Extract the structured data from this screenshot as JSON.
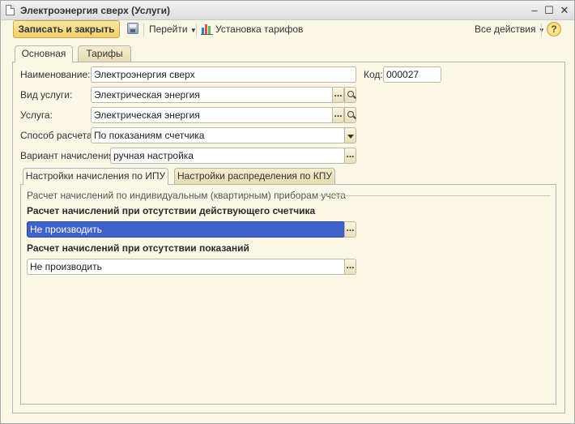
{
  "window": {
    "title": "Электроэнергия сверх (Услуги)",
    "controls": {
      "minimize": "‒",
      "maximize": "☐",
      "close": "✕"
    }
  },
  "toolbar": {
    "save_close_label": "Записать и закрыть",
    "goto_label": "Перейти",
    "tariffs_label": "Установка тарифов",
    "all_actions_label": "Все действия",
    "help_label": "?"
  },
  "tabs": {
    "main": "Основная",
    "tariffs": "Тарифы"
  },
  "form": {
    "name_label": "Наименование:",
    "name_value": "Электроэнергия сверх",
    "code_label": "Код:",
    "code_value": "000027",
    "service_type_label": "Вид услуги:",
    "service_type_value": "Электрическая энергия",
    "service_label": "Услуга:",
    "service_value": "Электрическая энергия",
    "calc_method_label": "Способ расчета:",
    "calc_method_value": "По показаниям счетчика",
    "accrual_variant_label": "Вариант начисления:",
    "accrual_variant_value": "ручная настройка",
    "choose_button": "..."
  },
  "subtabs": {
    "ipu": "Настройки начисления по ИПУ",
    "kpu": "Настройки распределения по КПУ"
  },
  "ipu_settings": {
    "group_title": "Расчет начислений по индивидуальным (квартирным) приборам учета",
    "no_meter_label": "Расчет начислений при отсутствии действующего счетчика",
    "no_meter_value": "Не производить",
    "no_readings_label": "Расчет начислений при отсутствии показаний",
    "no_readings_value": "Не производить"
  },
  "colors": {
    "background": "#fbf7e6",
    "save_button": "#f1cf6b",
    "selection": "#3f62c9"
  },
  "icons": {
    "doc": "doc-icon",
    "floppy": "floppy-icon",
    "chart": "bar-chart-icon",
    "search": "search-icon",
    "dropdown": "chevron-down-icon",
    "help": "help-icon"
  }
}
